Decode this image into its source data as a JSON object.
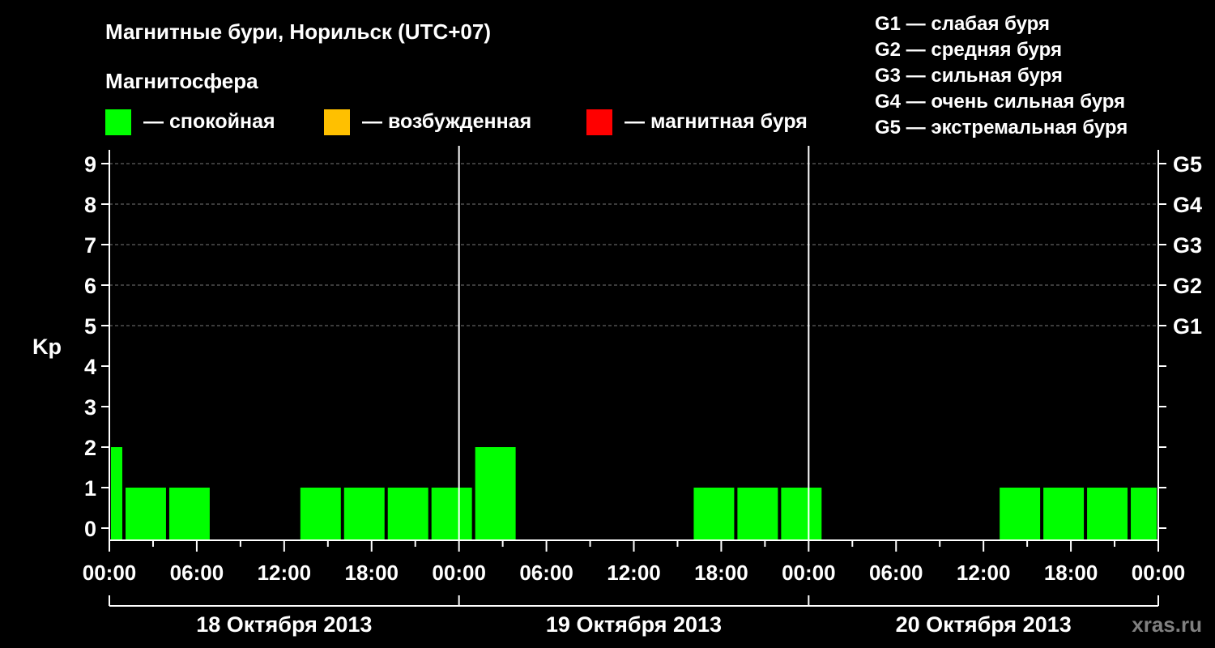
{
  "header": {
    "title": "Магнитные бури, Норильск (UTC+07)",
    "magnetosphere_label": "Магнитосфера"
  },
  "legend": {
    "states": [
      {
        "label": "— спокойная",
        "color": "#00ff00"
      },
      {
        "label": "— возбужденная",
        "color": "#ffc000"
      },
      {
        "label": "— магнитная буря",
        "color": "#ff0000"
      }
    ],
    "g_levels": [
      "G1 — слабая буря",
      "G2 — средняя буря",
      "G3 — сильная буря",
      "G4 — очень сильная буря",
      "G5 — экстремальная буря"
    ]
  },
  "watermark": "xras.ru",
  "chart_data": {
    "type": "bar",
    "ylabel": "Kp",
    "ylim": [
      0,
      9
    ],
    "y_ticks": [
      "0",
      "1",
      "2",
      "3",
      "4",
      "5",
      "6",
      "7",
      "8",
      "9"
    ],
    "right_axis_labels": [
      {
        "kp": 5,
        "label": "G1"
      },
      {
        "kp": 6,
        "label": "G2"
      },
      {
        "kp": 7,
        "label": "G3"
      },
      {
        "kp": 8,
        "label": "G4"
      },
      {
        "kp": 9,
        "label": "G5"
      }
    ],
    "x_ticks": [
      "00:00",
      "06:00",
      "12:00",
      "18:00",
      "00:00",
      "06:00",
      "12:00",
      "18:00",
      "00:00",
      "06:00",
      "12:00",
      "18:00",
      "00:00"
    ],
    "days": [
      "18 Октября 2013",
      "19 Октября 2013",
      "20 Октября 2013"
    ],
    "grid": "dashed horizontal at Kp 5-9",
    "bar_color": "#00ff00",
    "bars": [
      {
        "start_hour": 0,
        "end_hour": 1,
        "kp": 2
      },
      {
        "start_hour": 1,
        "end_hour": 4,
        "kp": 1
      },
      {
        "start_hour": 4,
        "end_hour": 7,
        "kp": 1
      },
      {
        "start_hour": 7,
        "end_hour": 10,
        "kp": 0
      },
      {
        "start_hour": 10,
        "end_hour": 13,
        "kp": 0
      },
      {
        "start_hour": 13,
        "end_hour": 16,
        "kp": 1
      },
      {
        "start_hour": 16,
        "end_hour": 19,
        "kp": 1
      },
      {
        "start_hour": 19,
        "end_hour": 22,
        "kp": 1
      },
      {
        "start_hour": 22,
        "end_hour": 25,
        "kp": 1
      },
      {
        "start_hour": 25,
        "end_hour": 28,
        "kp": 2
      },
      {
        "start_hour": 28,
        "end_hour": 31,
        "kp": 0
      },
      {
        "start_hour": 31,
        "end_hour": 34,
        "kp": 0
      },
      {
        "start_hour": 34,
        "end_hour": 37,
        "kp": 0
      },
      {
        "start_hour": 37,
        "end_hour": 40,
        "kp": 0
      },
      {
        "start_hour": 40,
        "end_hour": 43,
        "kp": 1
      },
      {
        "start_hour": 43,
        "end_hour": 46,
        "kp": 1
      },
      {
        "start_hour": 46,
        "end_hour": 49,
        "kp": 1
      },
      {
        "start_hour": 49,
        "end_hour": 52,
        "kp": 0
      },
      {
        "start_hour": 52,
        "end_hour": 55,
        "kp": 0
      },
      {
        "start_hour": 55,
        "end_hour": 58,
        "kp": 0
      },
      {
        "start_hour": 58,
        "end_hour": 61,
        "kp": 0
      },
      {
        "start_hour": 61,
        "end_hour": 64,
        "kp": 1
      },
      {
        "start_hour": 64,
        "end_hour": 67,
        "kp": 1
      },
      {
        "start_hour": 67,
        "end_hour": 70,
        "kp": 1
      },
      {
        "start_hour": 70,
        "end_hour": 72,
        "kp": 1
      }
    ]
  }
}
